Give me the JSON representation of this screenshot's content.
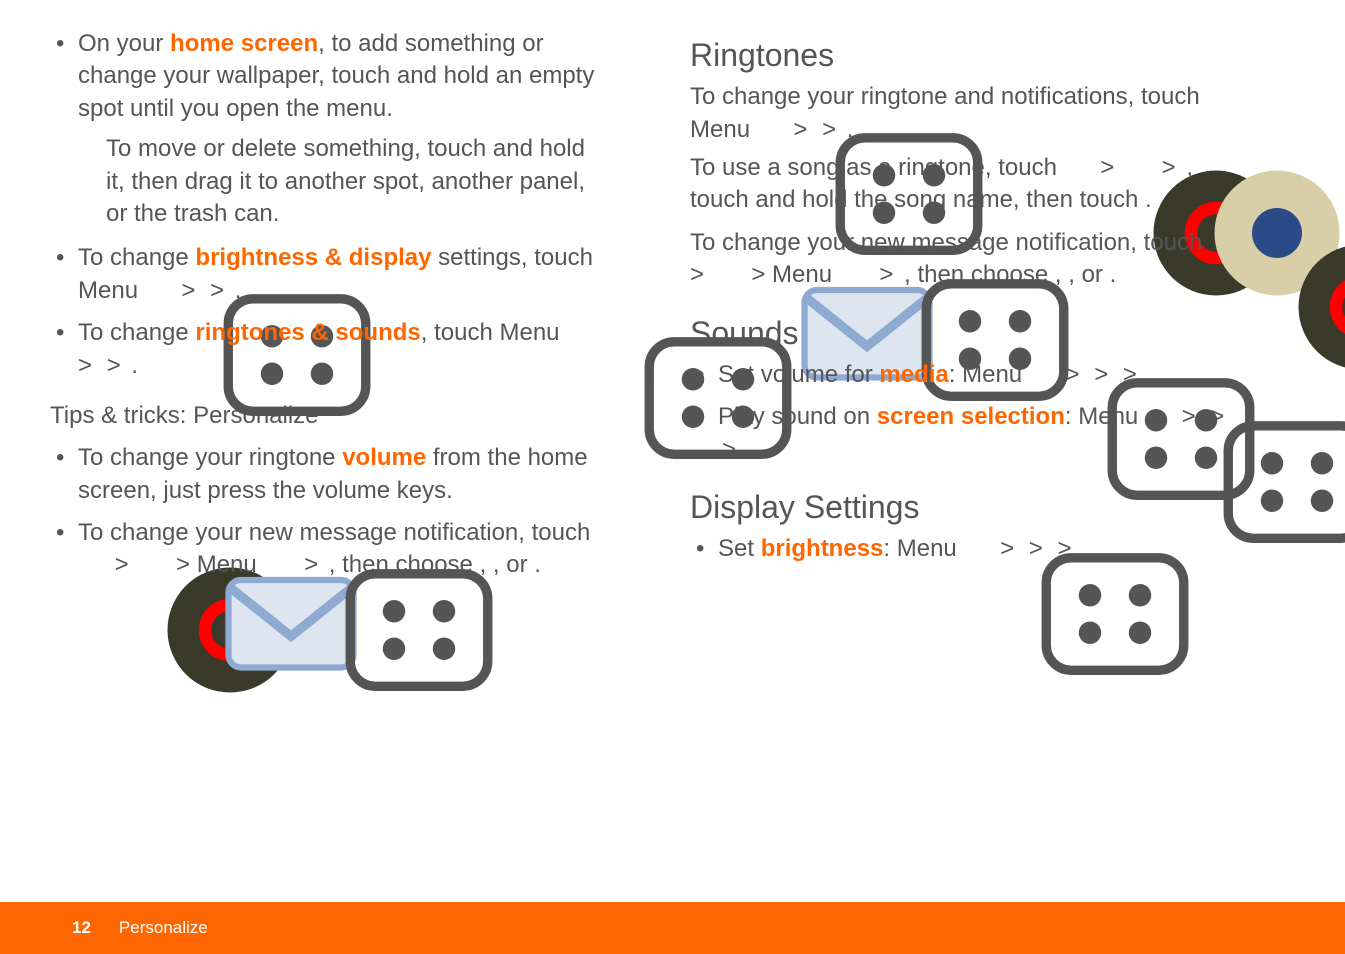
{
  "leftCol": {
    "items1": [
      {
        "pre": "On your ",
        "em": "home screen",
        "post": ", to add something or change your wallpaper, touch and hold an empty spot until you open the",
        "trail": " menu.",
        "sub": "To move or delete something, touch and hold it, then drag it to another spot, another panel, or the trash can."
      },
      {
        "pre": "To change ",
        "em": "brightness & display",
        "post": " settings, touch Menu ",
        "trail2a": " > ",
        "trail2b": " > ",
        "trail2c": "."
      },
      {
        "pre": "To change ",
        "em": "ringtones & sounds",
        "post": ", touch Menu ",
        "trail3a": " > ",
        "trail3b": " > ",
        "trail3c": "."
      }
    ],
    "tips": "Tips & tricks: Personalize",
    "items2": [
      {
        "pre": "To change your ringtone ",
        "em": "volume",
        "post": " from the home screen, just press the volume keys."
      },
      {
        "text1": "To change your new message notification, touch ",
        "text2": " > ",
        "text3": " > Menu ",
        "text4": " > ",
        "text5": ", then choose ",
        "text6": ", ",
        "text7": ", or ",
        "text8": "."
      }
    ]
  },
  "rightCol": {
    "h_ringtones": "Ringtones",
    "r_p1a": "To change your ringtone and notifications, touch Menu ",
    "r_p1b": " > ",
    "r_p1c": " > ",
    "r_p1d": ".",
    "r_p2a": "To use a song as a ringtone, touch ",
    "r_p2b": " > ",
    "r_p2c": " > ",
    "r_p2d": ", touch and hold the song name, then touch ",
    "r_p2e": ".",
    "r_p3a": "To change your new message notification, touch ",
    "r_p3b": " > ",
    "r_p3c": " > Menu ",
    "r_p3d": " > ",
    "r_p3e": ", then choose ",
    "r_p3f": ", ",
    "r_p3g": ", or ",
    "r_p3h": ".",
    "h_sounds": "Sounds",
    "s1_pre": "Set volume for ",
    "s1_em": "media",
    "s1_post": ": Menu ",
    "s1_t1": " > ",
    "s1_t2": " > ",
    "s1_t3": " > ",
    "s2_pre": "Play sound on ",
    "s2_em": "screen selection",
    "s2_post": ": Menu ",
    "s2_t1": " > ",
    "s2_t2": " > ",
    "s2_t3": " > ",
    "h_display": "Display Settings",
    "d1_pre": "Set ",
    "d1_em": "brightness",
    "d1_post": ": Menu ",
    "d1_t1": " > ",
    "d1_t2": " > ",
    "d1_t3": " > "
  },
  "footer": {
    "page": "12",
    "section": "Personalize"
  }
}
